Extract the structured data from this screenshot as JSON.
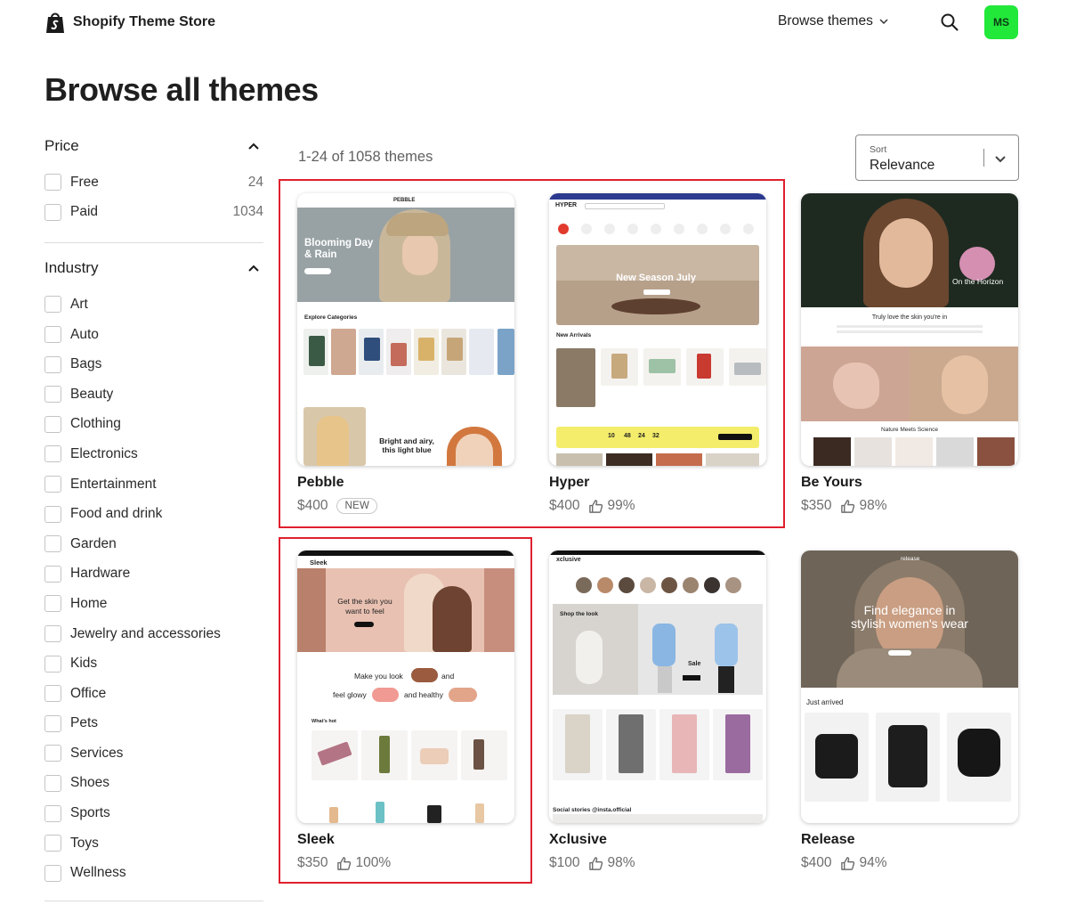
{
  "header": {
    "logo_text": "Shopify Theme Store",
    "browse_label": "Browse themes",
    "avatar_initials": "MS",
    "avatar_color": "#22e83a"
  },
  "page_title": "Browse all themes",
  "filters": {
    "price": {
      "title": "Price",
      "options": [
        {
          "label": "Free",
          "count": "24"
        },
        {
          "label": "Paid",
          "count": "1034"
        }
      ]
    },
    "industry": {
      "title": "Industry",
      "options": [
        {
          "label": "Art"
        },
        {
          "label": "Auto"
        },
        {
          "label": "Bags"
        },
        {
          "label": "Beauty"
        },
        {
          "label": "Clothing"
        },
        {
          "label": "Electronics"
        },
        {
          "label": "Entertainment"
        },
        {
          "label": "Food and drink"
        },
        {
          "label": "Garden"
        },
        {
          "label": "Hardware"
        },
        {
          "label": "Home"
        },
        {
          "label": "Jewelry and accessories"
        },
        {
          "label": "Kids"
        },
        {
          "label": "Office"
        },
        {
          "label": "Pets"
        },
        {
          "label": "Services"
        },
        {
          "label": "Shoes"
        },
        {
          "label": "Sports"
        },
        {
          "label": "Toys"
        },
        {
          "label": "Wellness"
        }
      ]
    }
  },
  "results": {
    "count_text": "1-24 of 1058 themes",
    "sort_label": "Sort",
    "sort_value": "Relevance"
  },
  "highlight_color": "#e0202e",
  "themes": [
    {
      "name": "Pebble",
      "price": "$400",
      "badge": "NEW",
      "rating": ""
    },
    {
      "name": "Hyper",
      "price": "$400",
      "badge": "",
      "rating": "99%"
    },
    {
      "name": "Be Yours",
      "price": "$350",
      "badge": "",
      "rating": "98%"
    },
    {
      "name": "Sleek",
      "price": "$350",
      "badge": "",
      "rating": "100%"
    },
    {
      "name": "Xclusive",
      "price": "$100",
      "badge": "",
      "rating": "98%"
    },
    {
      "name": "Release",
      "price": "$400",
      "badge": "",
      "rating": "94%"
    }
  ],
  "thumbnails": {
    "pebble": {
      "brand": "PEBBLE",
      "hero_title": "Blooming Day & Rain",
      "section": "Explore Categories",
      "promo": "Bright and airy, this light blue"
    },
    "hyper": {
      "brand": "HYPER",
      "hero_title": "New Season July",
      "section": "New Arrivals",
      "countdown": [
        "10",
        "48",
        "24",
        "32"
      ]
    },
    "beyours": {
      "hero_title": "On the Horizon",
      "tagline": "Truly love the skin you're in",
      "section": "Nature Meets Science"
    },
    "sleek": {
      "brand": "Sleek",
      "hero_title": "Get the skin you want to feel",
      "line1": "Make you look",
      "line1b": "and",
      "line2": "feel glowy",
      "line2b": "and healthy",
      "tab": "What's hot"
    },
    "xclusive": {
      "brand": "xclusive",
      "hero_title": "Shop the look",
      "sale": "Sale",
      "section": "Social stories @insta.official"
    },
    "release": {
      "brand": "release",
      "hero_title": "Find elegance in stylish women's wear",
      "section": "Just arrived"
    }
  }
}
